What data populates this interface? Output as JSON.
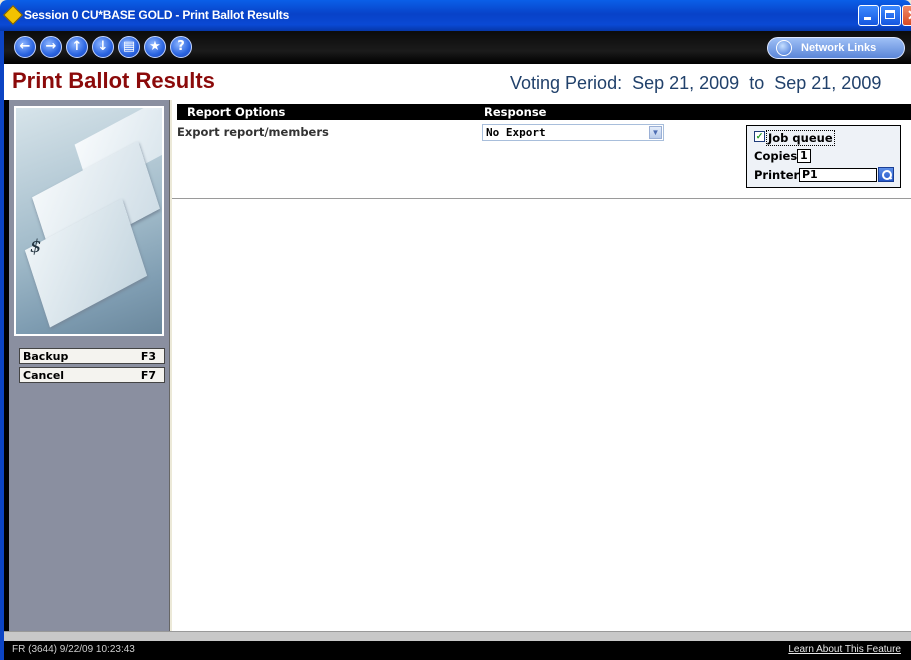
{
  "window": {
    "title": "Session 0 CU*BASE GOLD - Print Ballot Results"
  },
  "toolbar": {
    "nav_buttons": [
      {
        "name": "back-icon",
        "glyph": "←"
      },
      {
        "name": "forward-icon",
        "glyph": "→"
      },
      {
        "name": "up-icon",
        "glyph": "↑"
      },
      {
        "name": "down-icon",
        "glyph": "↓"
      },
      {
        "name": "print-icon",
        "glyph": "▤"
      },
      {
        "name": "favorite-icon",
        "glyph": "★"
      },
      {
        "name": "help-icon",
        "glyph": "?"
      }
    ],
    "network_links_label": "Network Links"
  },
  "header": {
    "page_title": "Print Ballot Results",
    "voting_period_label": "Voting Period:",
    "start_date": "Sep 21, 2009",
    "to_label": "to",
    "end_date": "Sep 21, 2009"
  },
  "sidebar": {
    "function_keys": [
      {
        "label": "Backup",
        "key": "F3"
      },
      {
        "label": "Cancel",
        "key": "F7"
      }
    ]
  },
  "main": {
    "col_report_options": "Report Options",
    "col_response": "Response",
    "option_label": "Export report/members",
    "export_value": "No Export",
    "job_queue_label": "Job queue",
    "job_queue_checked": true,
    "copies_label": "Copies",
    "copies_value": "1",
    "printer_label": "Printer",
    "printer_value": "P1"
  },
  "status": {
    "left": "FR (3644) 9/22/09 10:23:43",
    "right": "Learn About This Feature"
  },
  "colors": {
    "title_red": "#8b0a0a",
    "voting_blue": "#21416b",
    "title_bar_blue": "#0842c8"
  }
}
